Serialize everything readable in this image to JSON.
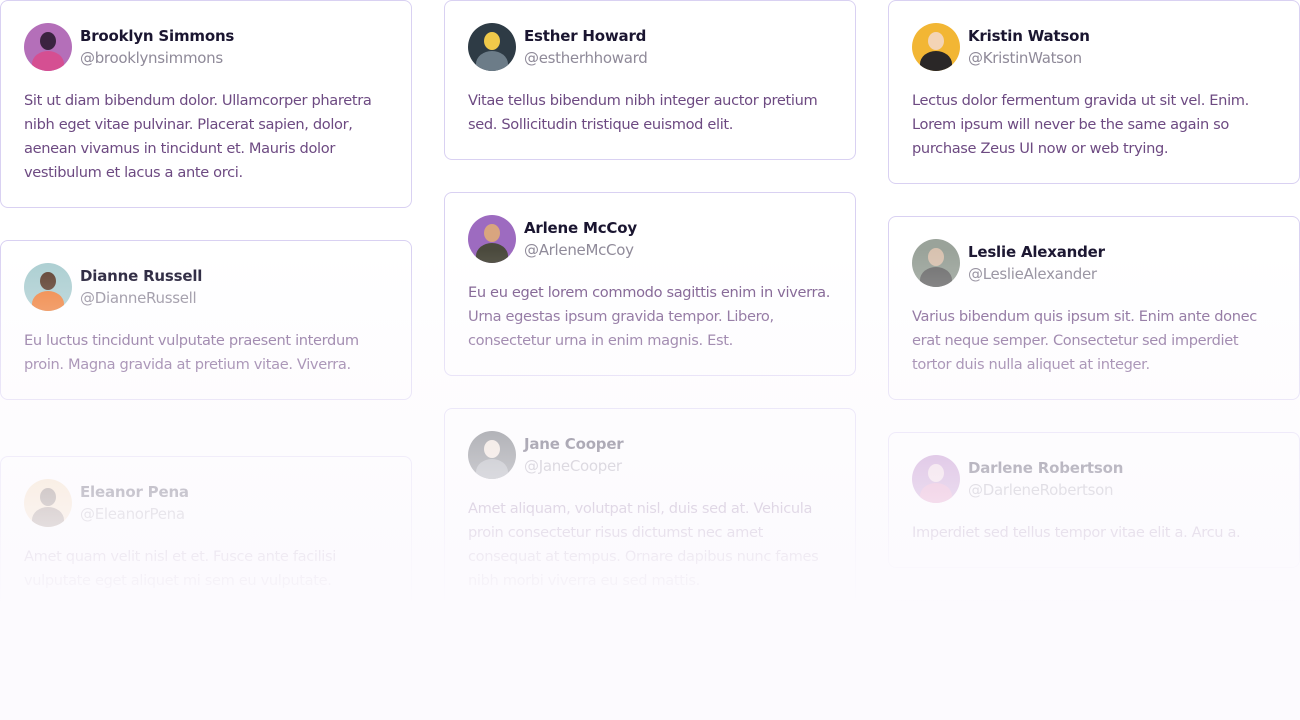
{
  "testimonials": [
    {
      "name": "Brooklyn Simmons",
      "handle": "@brooklynsimmons",
      "text": "Sit ut diam bibendum dolor. Ullamcorper pharetra nibh eget vitae pulvinar. Placerat sapien, dolor, aenean vivamus in tincidunt et. Mauris dolor vestibulum et lacus a ante orci.",
      "avatar_bg": "#b46fb9",
      "avatar_face": "#3b2340",
      "avatar_body": "#d54f92"
    },
    {
      "name": "Esther Howard",
      "handle": "@estherhhoward",
      "text": "Vitae tellus bibendum nibh integer auctor pretium sed. Sollicitudin tristique euismod elit.",
      "avatar_bg": "#2e3b45",
      "avatar_face": "#f0c94a",
      "avatar_body": "#6c7c88"
    },
    {
      "name": "Kristin Watson",
      "handle": "@KristinWatson",
      "text": "Lectus dolor fermentum gravida ut sit vel. Enim. Lorem ipsum will never be the same again so purchase Zeus UI now or web trying.",
      "avatar_bg": "#f2b634",
      "avatar_face": "#f3d4b6",
      "avatar_body": "#2a2727"
    },
    {
      "name": "Dianne Russell",
      "handle": "@DianneRussell",
      "text": "Eu luctus tincidunt vulputate praesent interdum proin. Magna gravida at pretium vitae. Viverra.",
      "avatar_bg": "#a9cdd0",
      "avatar_face": "#5a3b2a",
      "avatar_body": "#ef7f38"
    },
    {
      "name": "Arlene McCoy",
      "handle": "@ArleneMcCoy",
      "text": "Eu eu eget lorem commodo sagittis enim in viverra. Urna egestas ipsum gravida tempor. Libero, consectetur urna in enim magnis. Est.",
      "avatar_bg": "#9d6bc0",
      "avatar_face": "#d9a57f",
      "avatar_body": "#4b4a3d"
    },
    {
      "name": "Leslie Alexander",
      "handle": "@LeslieAlexander",
      "text": "Varius bibendum quis ipsum sit. Enim ante donec erat neque semper. Consectetur sed imperdiet tortor duis nulla aliquet at integer.",
      "avatar_bg": "#9aa39a",
      "avatar_face": "#d8c2b0",
      "avatar_body": "#6e6e6e"
    },
    {
      "name": "Eleanor Pena",
      "handle": "@EleanorPena",
      "text": "Amet quam velit nisl et et. Fusce ante facilisi vulputate eget aliquet mi sem eu vulputate.",
      "avatar_bg": "#f1cfa0",
      "avatar_face": "#4a3123",
      "avatar_body": "#5b3d2c"
    },
    {
      "name": "Jane Cooper",
      "handle": "@JaneCooper",
      "text": "Amet aliquam, volutpat nisl, duis sed at. Vehicula proin consectetur risus dictumst nec amet consequat at tempus. Ornare dapibus nunc fames nibh morbi viverra eu sed mattis.",
      "avatar_bg": "#3b4047",
      "avatar_face": "#e8d6c4",
      "avatar_body": "#777d85"
    },
    {
      "name": "Darlene Robertson",
      "handle": "@DarleneRobertson",
      "text": "Imperdiet sed tellus tempor vitae elit a. Arcu a.",
      "avatar_bg": "#a865b8",
      "avatar_face": "#e8c3d3",
      "avatar_body": "#d66ba8"
    }
  ]
}
